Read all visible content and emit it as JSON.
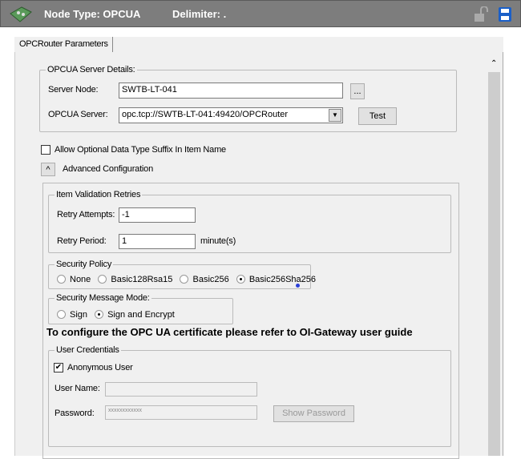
{
  "header": {
    "node_type": "Node Type: OPCUA",
    "delimiter": "Delimiter:  ."
  },
  "tabs": [
    {
      "label": "OPCRouter Parameters"
    }
  ],
  "server_details": {
    "title": "OPCUA Server Details:",
    "server_node_label": "Server Node:",
    "server_node_value": "SWTB-LT-041",
    "browse_label": "...",
    "opcua_server_label": "OPCUA Server:",
    "opcua_server_value": "opc.tcp://SWTB-LT-041:49420/OPCRouter",
    "test_label": "Test"
  },
  "allow_suffix": {
    "label": "Allow Optional Data Type Suffix In Item Name",
    "checked": false
  },
  "advanced": {
    "toggle": "^",
    "label": "Advanced Configuration"
  },
  "retries": {
    "title": "Item Validation Retries",
    "attempts_label": "Retry Attempts:",
    "attempts_value": "-1",
    "period_label": "Retry Period:",
    "period_value": "1",
    "period_unit": "minute(s)"
  },
  "security_policy": {
    "title": "Security Policy",
    "options": [
      "None",
      "Basic128Rsa15",
      "Basic256",
      "Basic256Sha256"
    ],
    "selected": "Basic256Sha256"
  },
  "message_mode": {
    "title": "Security Message Mode:",
    "options": [
      "Sign",
      "Sign and Encrypt"
    ],
    "selected": "Sign and Encrypt"
  },
  "note": "To configure the OPC UA certificate please refer to OI-Gateway user guide",
  "credentials": {
    "title": "User Credentials",
    "anonymous_label": "Anonymous User",
    "anonymous_checked": true,
    "username_label": "User Name:",
    "username_value": "",
    "password_label": "Password:",
    "password_value": "xxxxxxxxxxxx",
    "show_password_label": "Show Password"
  },
  "colors": {
    "header": "#7d7d7d",
    "save_icon": "#1a5fc8"
  }
}
